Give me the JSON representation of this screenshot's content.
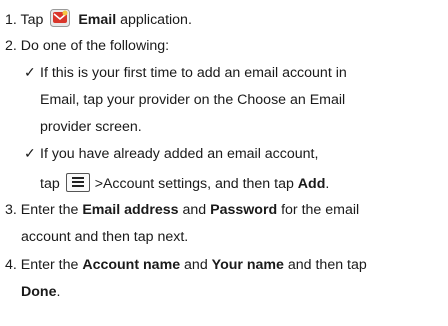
{
  "steps": {
    "s1": {
      "num": "1.",
      "pre": "Tap",
      "bold": "Email",
      "post": " application."
    },
    "s2": {
      "num": "2.",
      "text": "Do one of the following:"
    },
    "opt1": {
      "check": "✓",
      "line1": "If this is your first time to add an email account in",
      "line2": "Email, tap your provider on the Choose an Email",
      "line3": "provider screen."
    },
    "opt2": {
      "check": "✓",
      "line1": "If you have already added an email account,",
      "line2_pre": "tap",
      "line2_mid": ">Account settings, and then tap ",
      "line2_bold": "Add",
      "line2_end": "."
    },
    "s3": {
      "num": "3.",
      "pre": "Enter the ",
      "bold1": "Email address",
      "mid": " and ",
      "bold2": "Password",
      "post": " for the email",
      "line2": "account and then tap next."
    },
    "s4": {
      "num": "4.",
      "pre": "Enter the ",
      "bold1": "Account name",
      "mid": " and ",
      "bold2": "Your name",
      "post": " and then tap",
      "line2_bold": "Done",
      "line2_end": "."
    }
  },
  "icons": {
    "email_app": "email-app-icon",
    "menu_key": "menu-key-icon"
  },
  "colors": {
    "text": "#1a1a1a",
    "email_icon_red": "#d9362b"
  }
}
